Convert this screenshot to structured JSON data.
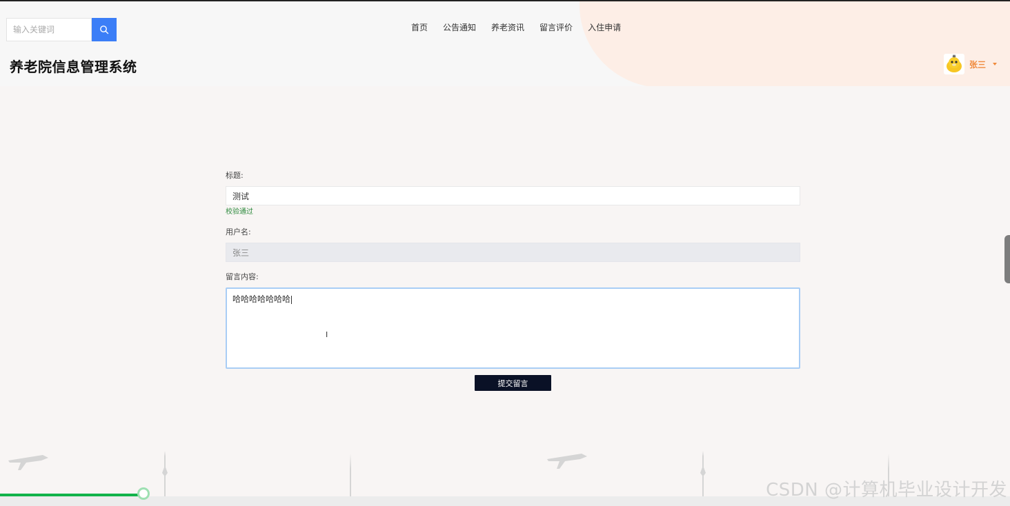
{
  "header": {
    "search": {
      "placeholder": "输入关键词",
      "value": ""
    },
    "site_title": "养老院信息管理系统",
    "nav": [
      "首页",
      "公告通知",
      "养老资讯",
      "留言评价",
      "入住申请"
    ],
    "user": {
      "name": "张三"
    }
  },
  "form": {
    "title": {
      "label": "标题:",
      "value": "测试",
      "hint": "校验通过"
    },
    "username": {
      "label": "用户名:",
      "value": "张三"
    },
    "content": {
      "label": "留言内容:",
      "value": "哈哈哈哈哈哈哈"
    },
    "submit_label": "提交留言"
  },
  "footer": {
    "watermark": "CSDN @计算机毕业设计开发",
    "progress_fraction": 0.142
  },
  "colors": {
    "accent": "#3b7ef7",
    "user_name": "#f08a3c",
    "valid": "#2e8b3e",
    "submit_bg": "#0a1126",
    "progress": "#11b34a"
  }
}
